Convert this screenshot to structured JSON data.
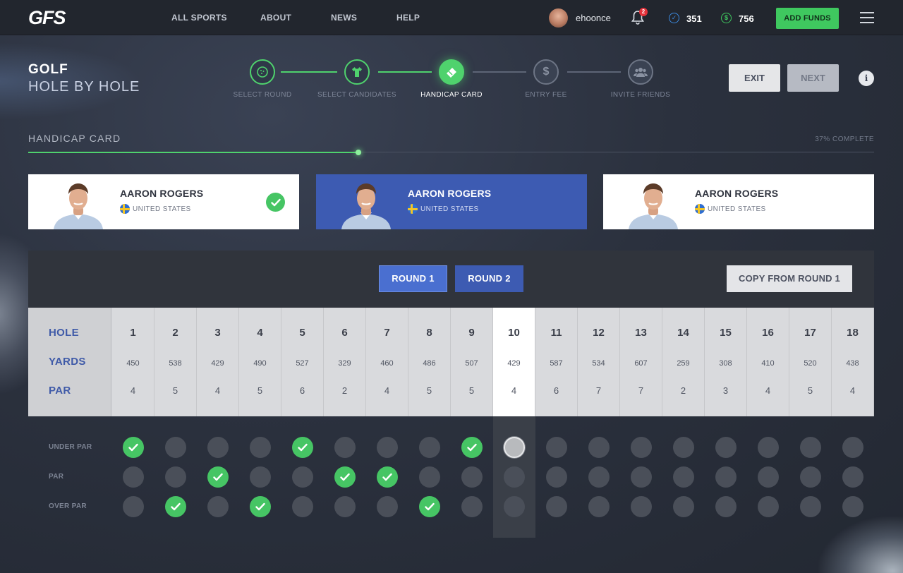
{
  "brand": {
    "logo": "GFS"
  },
  "nav": [
    {
      "label": "ALL SPORTS"
    },
    {
      "label": "ABOUT"
    },
    {
      "label": "NEWS"
    },
    {
      "label": "HELP"
    }
  ],
  "user": {
    "name": "ehoonce",
    "notifications": "2",
    "points": "351",
    "balance": "756",
    "add_funds_label": "ADD FUNDS"
  },
  "header": {
    "sport": "GOLF",
    "mode": "HOLE BY HOLE",
    "exit_label": "EXIT",
    "next_label": "NEXT",
    "info_label": "i"
  },
  "steps": [
    {
      "label": "SELECT ROUND",
      "state": "done",
      "icon": "golf-ball-icon"
    },
    {
      "label": "SELECT CANDIDATES",
      "state": "done",
      "icon": "shirt-icon"
    },
    {
      "label": "HANDICAP CARD",
      "state": "active",
      "icon": "card-icon"
    },
    {
      "label": "ENTRY FEE",
      "state": "future",
      "icon": "dollar-icon"
    },
    {
      "label": "INVITE FRIENDS",
      "state": "future",
      "icon": "group-icon"
    }
  ],
  "progress": {
    "title": "HANDICAP CARD",
    "complete_text": "37% COMPLETE",
    "percent": 39
  },
  "players": [
    {
      "name": "AARON ROGERS",
      "country": "UNITED STATES",
      "selected": false,
      "checked": true
    },
    {
      "name": "AARON ROGERS",
      "country": "UNITED STATES",
      "selected": true,
      "checked": false
    },
    {
      "name": "AARON ROGERS",
      "country": "UNITED STATES",
      "selected": false,
      "checked": false
    }
  ],
  "scorecard": {
    "rounds": [
      {
        "label": "ROUND 1",
        "active": true
      },
      {
        "label": "ROUND 2",
        "active": false
      }
    ],
    "copy_label": "COPY FROM ROUND 1",
    "row_labels": {
      "hole": "HOLE",
      "yards": "YARDS",
      "par": "PAR"
    },
    "current_hole": 10,
    "holes": [
      {
        "hole": "1",
        "yards": "450",
        "par": "4"
      },
      {
        "hole": "2",
        "yards": "538",
        "par": "5"
      },
      {
        "hole": "3",
        "yards": "429",
        "par": "4"
      },
      {
        "hole": "4",
        "yards": "490",
        "par": "5"
      },
      {
        "hole": "5",
        "yards": "527",
        "par": "6"
      },
      {
        "hole": "6",
        "yards": "329",
        "par": "2"
      },
      {
        "hole": "7",
        "yards": "460",
        "par": "4"
      },
      {
        "hole": "8",
        "yards": "486",
        "par": "5"
      },
      {
        "hole": "9",
        "yards": "507",
        "par": "5"
      },
      {
        "hole": "10",
        "yards": "429",
        "par": "4"
      },
      {
        "hole": "11",
        "yards": "587",
        "par": "6"
      },
      {
        "hole": "12",
        "yards": "534",
        "par": "7"
      },
      {
        "hole": "13",
        "yards": "607",
        "par": "7"
      },
      {
        "hole": "14",
        "yards": "259",
        "par": "2"
      },
      {
        "hole": "15",
        "yards": "308",
        "par": "3"
      },
      {
        "hole": "16",
        "yards": "410",
        "par": "4"
      },
      {
        "hole": "17",
        "yards": "520",
        "par": "5"
      },
      {
        "hole": "18",
        "yards": "438",
        "par": "4"
      }
    ]
  },
  "selection": {
    "rows": [
      "UNDER PAR",
      "PAR",
      "OVER PAR"
    ],
    "picks": [
      "under",
      "over",
      "par",
      "over",
      "under",
      "par",
      "par",
      "over",
      "under",
      null,
      null,
      null,
      null,
      null,
      null,
      null,
      null,
      null
    ]
  },
  "colors": {
    "accent_green": "#46c564",
    "selected_blue": "#3d5bb2",
    "round_active": "#4a6fd0",
    "round_inactive": "#3d5bb2"
  }
}
